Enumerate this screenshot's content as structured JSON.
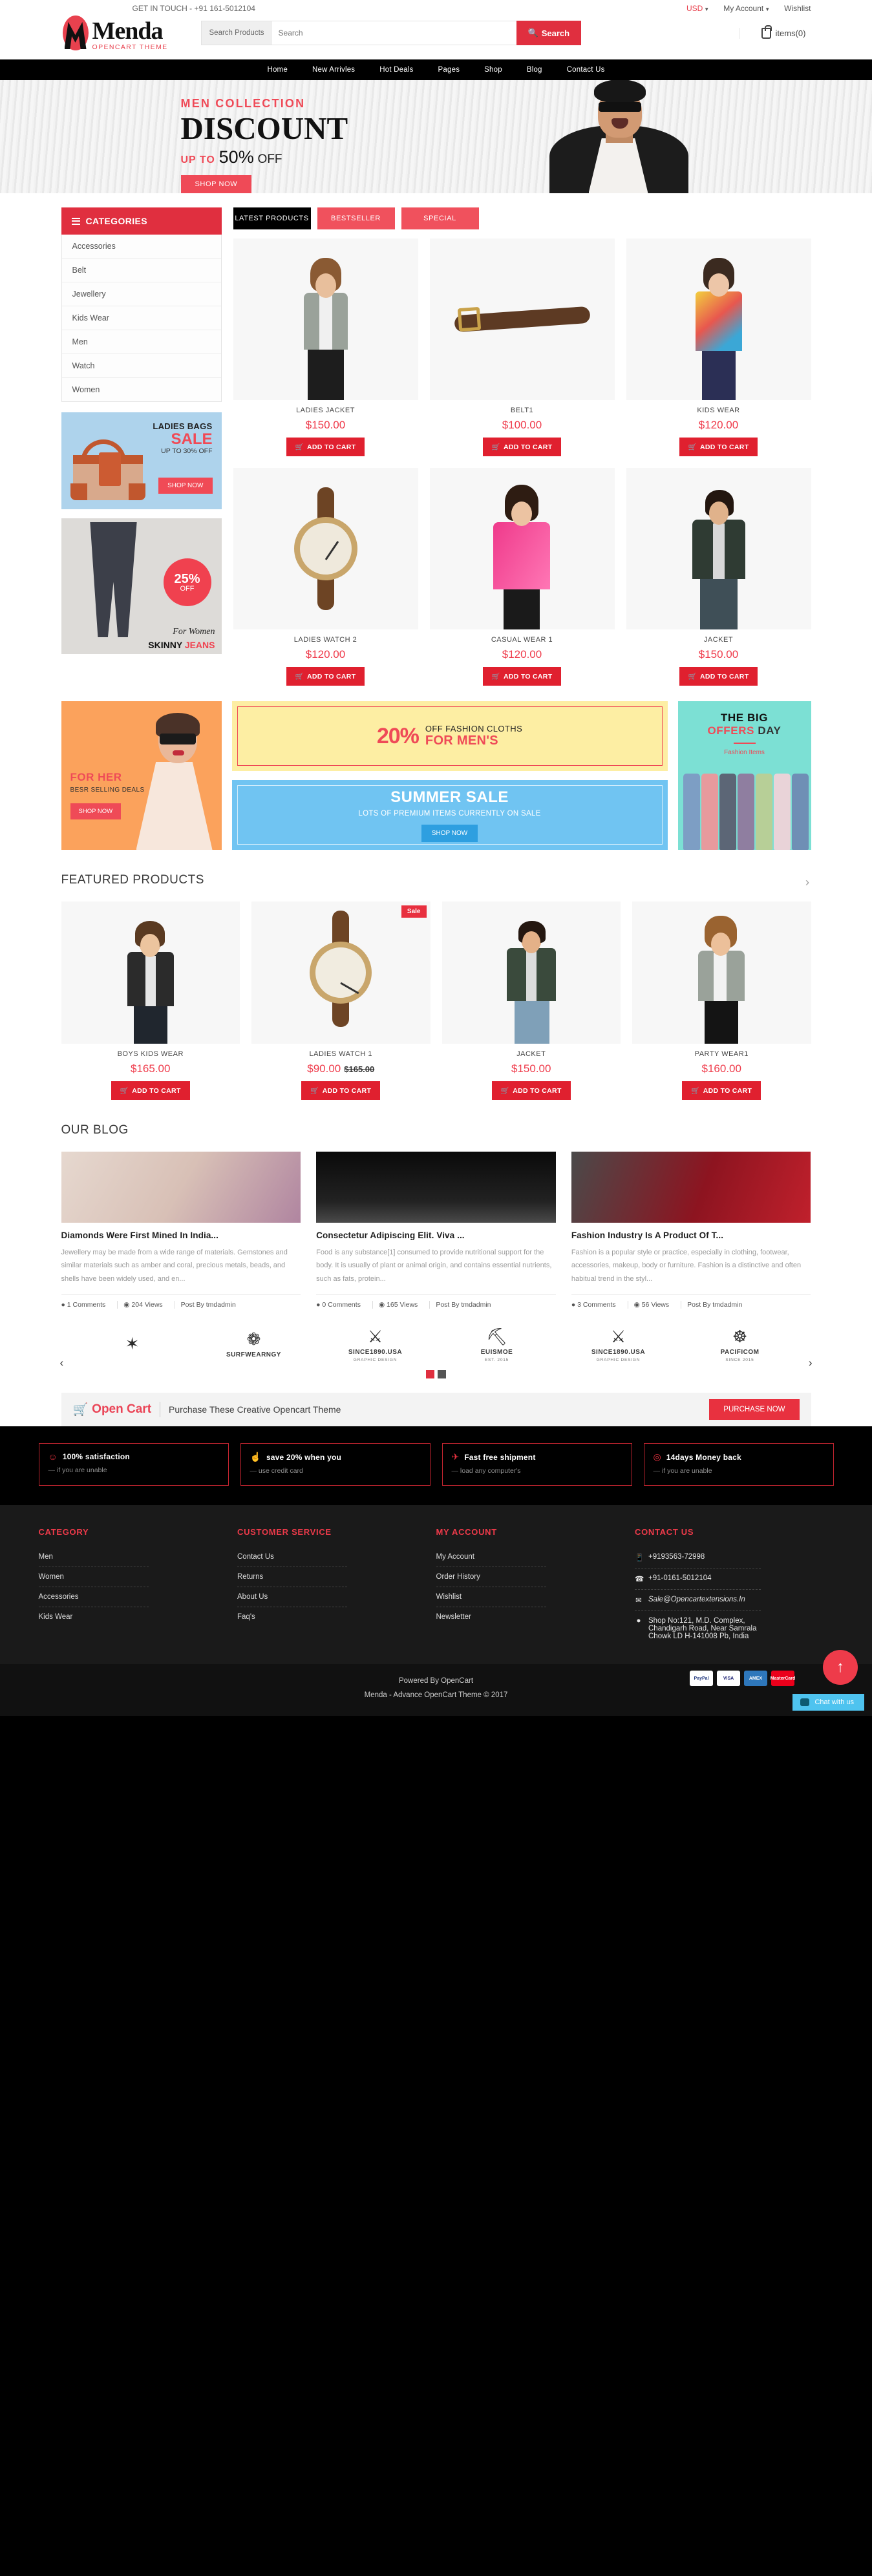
{
  "topbar": {
    "get_in_touch": "GET IN TOUCH - +91 161-5012104",
    "currency": "USD",
    "my_account": "My Account",
    "wishlist": "Wishlist"
  },
  "header": {
    "logo_name": "Menda",
    "logo_sub": "OPENCART THEME",
    "search_category": "Search Products",
    "search_placeholder": "Search",
    "search_button": "Search",
    "cart_label": "items(0)"
  },
  "nav": {
    "items": [
      {
        "label": "Home"
      },
      {
        "label": "New Arrivles"
      },
      {
        "label": "Hot Deals"
      },
      {
        "label": "Pages"
      },
      {
        "label": "Shop"
      },
      {
        "label": "Blog"
      },
      {
        "label": "Contact Us"
      }
    ]
  },
  "hero": {
    "kicker": "MEN COLLECTION",
    "title": "DISCOUNT",
    "upto": "UP TO",
    "percent": "50%",
    "off": "OFF",
    "button": "SHOP NOW"
  },
  "sidebar": {
    "title": "CATEGORIES",
    "categories": [
      {
        "label": "Accessories"
      },
      {
        "label": "Belt"
      },
      {
        "label": "Jewellery"
      },
      {
        "label": "Kids Wear"
      },
      {
        "label": "Men"
      },
      {
        "label": "Watch"
      },
      {
        "label": "Women"
      }
    ],
    "bags_banner": {
      "line1": "LADIES BAGS",
      "line2": "SALE",
      "line3": "UP TO 30% OFF",
      "button": "SHOP NOW"
    },
    "jeans_banner": {
      "badge_percent": "25%",
      "badge_off": "OFF",
      "caption1": "For Women",
      "caption2a": "SKINNY ",
      "caption2b": "JEANS"
    }
  },
  "product_tabs": [
    {
      "label": "LATEST PRODUCTS",
      "active": true
    },
    {
      "label": "BESTSELLER",
      "active": false
    },
    {
      "label": "SPECIAL",
      "active": false
    }
  ],
  "latest_products": [
    {
      "name": "LADIES JACKET",
      "price": "$150.00",
      "old_price": "",
      "button": "ADD TO CART",
      "badge": ""
    },
    {
      "name": "BELT1",
      "price": "$100.00",
      "old_price": "",
      "button": "ADD TO CART",
      "badge": ""
    },
    {
      "name": "KIDS WEAR",
      "price": "$120.00",
      "old_price": "",
      "button": "ADD TO CART",
      "badge": ""
    },
    {
      "name": "LADIES WATCH 2",
      "price": "$120.00",
      "old_price": "",
      "button": "ADD TO CART",
      "badge": ""
    },
    {
      "name": "CASUAL WEAR 1",
      "price": "$120.00",
      "old_price": "",
      "button": "ADD TO CART",
      "badge": ""
    },
    {
      "name": "JACKET",
      "price": "$150.00",
      "old_price": "",
      "button": "ADD TO CART",
      "badge": ""
    }
  ],
  "promos": {
    "for_her": {
      "title": "FOR HER",
      "subtitle": "BESR SELLING DEALS",
      "button": "SHOP NOW"
    },
    "twenty": {
      "percent": "20%",
      "line1": "OFF FASHION CLOTHS",
      "line2": "FOR MEN'S"
    },
    "summer": {
      "title": "SUMMER SALE",
      "subtitle": "LOTS OF PREMIUM ITEMS CURRENTLY ON SALE",
      "button": "SHOP NOW"
    },
    "big_day": {
      "line1": "THE BIG",
      "line2a": "OFFERS",
      "line2b": " DAY",
      "line3": "Fashion Items"
    }
  },
  "featured": {
    "title": "FEATURED PRODUCTS",
    "products": [
      {
        "name": "BOYS KIDS WEAR",
        "price": "$165.00",
        "old_price": "",
        "button": "ADD TO CART",
        "badge": ""
      },
      {
        "name": "LADIES WATCH 1",
        "price": "$90.00",
        "old_price": "$165.00",
        "button": "ADD TO CART",
        "badge": "Sale"
      },
      {
        "name": "JACKET",
        "price": "$150.00",
        "old_price": "",
        "button": "ADD TO CART",
        "badge": ""
      },
      {
        "name": "PARTY WEAR1",
        "price": "$160.00",
        "old_price": "",
        "button": "ADD TO CART",
        "badge": ""
      }
    ]
  },
  "blog": {
    "title": "OUR BLOG",
    "posts": [
      {
        "title": "Diamonds Were First Mined In India...",
        "excerpt": "Jewellery may be made from a wide range of materials. Gemstones and similar materials such as amber and coral, precious metals, beads, and shells have been widely used, and en...",
        "comments": "1 Comments",
        "views": "204 Views",
        "author": "Post By tmdadmin"
      },
      {
        "title": "Consectetur Adipiscing Elit. Viva ...",
        "excerpt": "Food is any substance[1] consumed to provide nutritional support for the body. It is usually of plant or animal origin, and contains essential nutrients, such as fats, protein...",
        "comments": "0 Comments",
        "views": "165 Views",
        "author": "Post By tmdadmin"
      },
      {
        "title": "Fashion Industry Is A Product Of T...",
        "excerpt": "Fashion is a popular style or practice, especially in clothing, footwear, accessories, makeup, body or furniture. Fashion is a distinctive and often habitual trend in the styl...",
        "comments": "3 Comments",
        "views": "56 Views",
        "author": "Post By tmdadmin"
      }
    ]
  },
  "brands": [
    {
      "glyph": "✶",
      "name": "",
      "sub": ""
    },
    {
      "glyph": "❁",
      "name": "SURFWEARNGY",
      "sub": ""
    },
    {
      "glyph": "⚔",
      "name": "SINCE1890.USA",
      "sub": "GRAPHIC DESIGN"
    },
    {
      "glyph": "⛏",
      "name": "EUISMOE",
      "sub": "EST. 2015"
    },
    {
      "glyph": "⚔",
      "name": "SINCE1890.USA",
      "sub": "GRAPHIC DESIGN"
    },
    {
      "glyph": "☸",
      "name": "PACIFICOM",
      "sub": "SINCE 2015"
    }
  ],
  "opencart_bar": {
    "logo": "Open Cart",
    "text": "Purchase These Creative Opencart Theme",
    "button": "PURCHASE NOW"
  },
  "feature_strip": [
    {
      "icon": "☺",
      "title": "100% satisfaction",
      "sub": "if you are unable"
    },
    {
      "icon": "☝",
      "title": "save 20% when you",
      "sub": "use credit card"
    },
    {
      "icon": "✈",
      "title": "Fast free shipment",
      "sub": "load any computer's"
    },
    {
      "icon": "◎",
      "title": "14days Money back",
      "sub": "if you are unable"
    }
  ],
  "footer": {
    "columns": [
      {
        "heading": "CATEGORY",
        "links": [
          {
            "label": "Men"
          },
          {
            "label": "Women"
          },
          {
            "label": "Accessories"
          },
          {
            "label": "Kids Wear"
          }
        ]
      },
      {
        "heading": "CUSTOMER SERVICE",
        "links": [
          {
            "label": "Contact Us"
          },
          {
            "label": "Returns"
          },
          {
            "label": "About Us"
          },
          {
            "label": "Faq's"
          }
        ]
      },
      {
        "heading": "MY ACCOUNT",
        "links": [
          {
            "label": "My Account"
          },
          {
            "label": "Order History"
          },
          {
            "label": "Wishlist"
          },
          {
            "label": "Newsletter"
          }
        ]
      }
    ],
    "contact": {
      "heading": "CONTACT US",
      "mobile": "+9193563-72998",
      "phone": "+91-0161-5012104",
      "email": "Sale@Opencartextensions.In",
      "address": "Shop No:121, M.D. Complex, Chandigarh Road, Near Samrala Chowk LD H-141008 Pb, India"
    },
    "bottom": {
      "powered": "Powered By OpenCart",
      "copyright": "Menda - Advance OpenCart Theme © 2017"
    },
    "payments": [
      {
        "label": "PayPal"
      },
      {
        "label": "VISA"
      },
      {
        "label": "AMEX"
      },
      {
        "label": "MasterCard"
      }
    ],
    "chat": "Chat with us",
    "to_top": "↑"
  }
}
